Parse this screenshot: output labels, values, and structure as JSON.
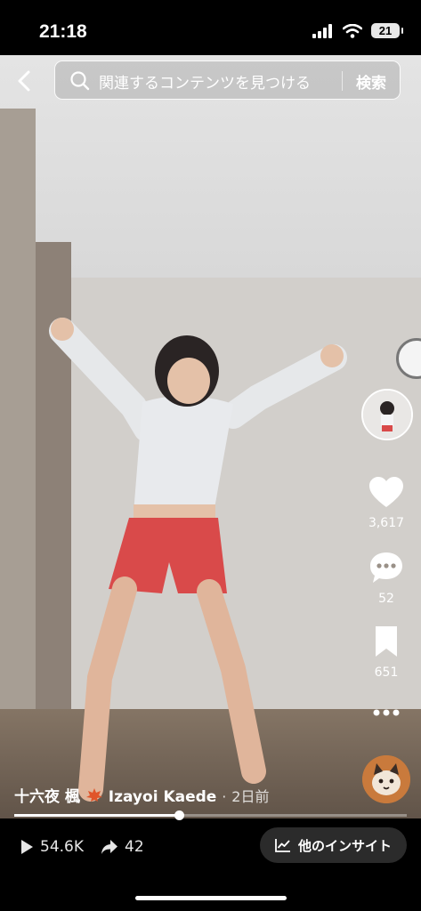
{
  "status": {
    "time": "21:18",
    "battery": "21"
  },
  "search": {
    "placeholder": "関連するコンテンツを見つける",
    "button": "検索"
  },
  "actions": {
    "likes": "3,617",
    "comments": "52",
    "saves": "651"
  },
  "caption": {
    "name": "十六夜 楓",
    "handle": "Izayoi Kaede",
    "separator": "·",
    "time": "2日前"
  },
  "progress": {
    "fraction": 0.42
  },
  "stats": {
    "plays": "54.6K",
    "shares": "42"
  },
  "insight": {
    "label": "他のインサイト"
  },
  "icons": {
    "back": "chevron-left-icon",
    "search": "search-icon",
    "like": "heart-icon",
    "comment": "comment-bubble-icon",
    "save": "bookmark-icon",
    "more": "more-dots-icon",
    "play": "play-icon",
    "share": "share-arrow-icon",
    "insight": "chart-line-icon",
    "maple": "maple-leaf-icon"
  },
  "colors": {
    "accent_maple": "#e0552a",
    "progress": "#ffffff",
    "insight_bg": "#2b2b2b"
  }
}
